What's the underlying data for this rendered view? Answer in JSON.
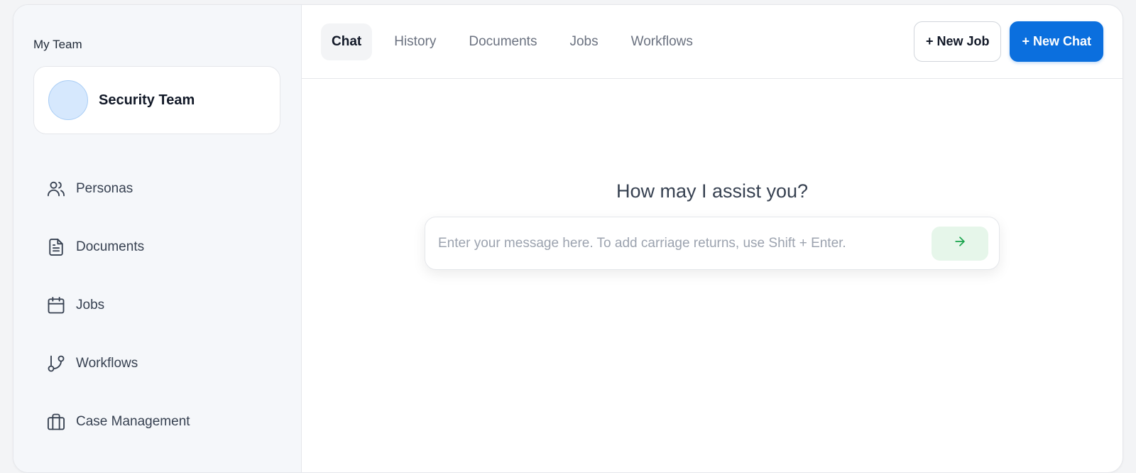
{
  "sidebar": {
    "team_label": "My Team",
    "team_card": {
      "name": "Security Team"
    },
    "items": [
      {
        "label": "Personas",
        "icon": "users-icon"
      },
      {
        "label": "Documents",
        "icon": "document-icon"
      },
      {
        "label": "Jobs",
        "icon": "calendar-icon"
      },
      {
        "label": "Workflows",
        "icon": "git-branch-icon"
      },
      {
        "label": "Case Management",
        "icon": "briefcase-icon"
      }
    ]
  },
  "header": {
    "tabs": [
      {
        "label": "Chat",
        "active": true
      },
      {
        "label": "History",
        "active": false
      },
      {
        "label": "Documents",
        "active": false
      },
      {
        "label": "Jobs",
        "active": false
      },
      {
        "label": "Workflows",
        "active": false
      }
    ],
    "new_job_label": "+ New Job",
    "new_chat_label": "+ New Chat"
  },
  "main": {
    "prompt": "How may I assist you?",
    "input": {
      "value": "",
      "placeholder": "Enter your message here. To add carriage returns, use Shift + Enter."
    }
  },
  "colors": {
    "primary": "#0b6fde",
    "send_bg": "#e6f6ea",
    "send_icon": "#16a34a",
    "sidebar_bg": "#f5f7fa",
    "avatar_bg": "#d6e8fd"
  }
}
